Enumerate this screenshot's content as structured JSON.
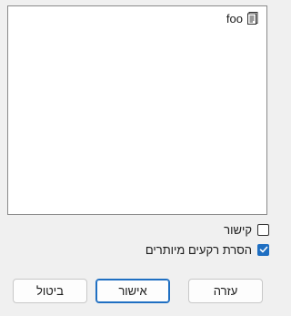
{
  "file_list": {
    "items": [
      {
        "label": "foo",
        "icon": "document-icon"
      }
    ]
  },
  "options": {
    "link": {
      "label": "קישור",
      "checked": false
    },
    "strip_whitespace": {
      "label": "הסרת רקעים מיותרים",
      "checked": true
    }
  },
  "buttons": {
    "help": "עזרה",
    "ok": "אישור",
    "cancel": "ביטול"
  },
  "colors": {
    "accent": "#1f6fc2",
    "background": "#f0f0f0"
  }
}
